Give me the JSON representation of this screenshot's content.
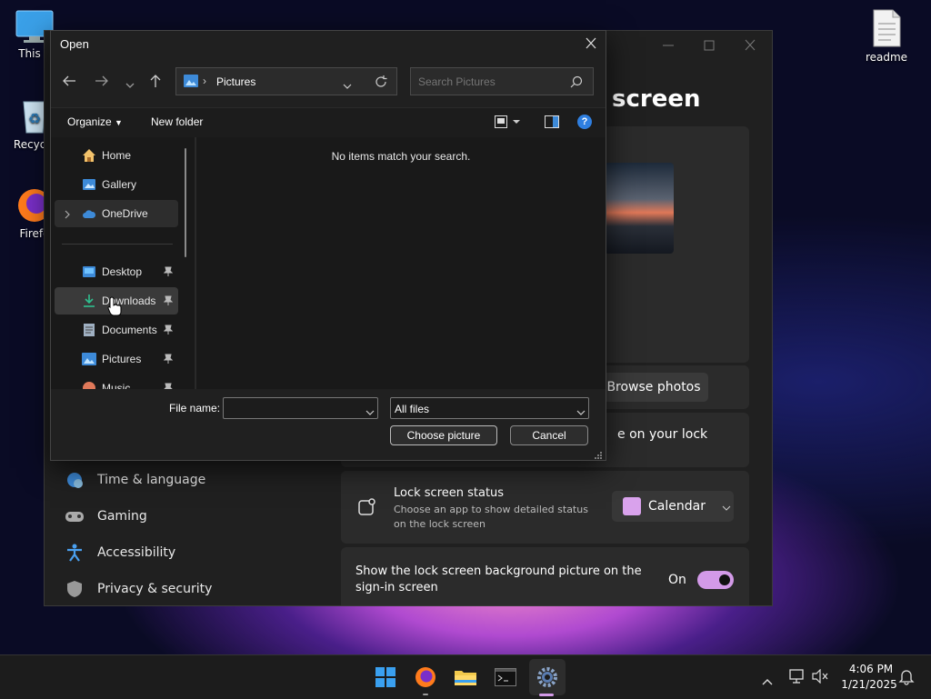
{
  "desktop": {
    "this_pc_label": "This P",
    "recycle_label": "Recycle",
    "firefox_label": "Firefo",
    "readme_label": "readme"
  },
  "settings": {
    "heading": "screen",
    "browse_photos": "Browse photos",
    "partial_text": "e on your lock",
    "nav": [
      {
        "label": "Time & language"
      },
      {
        "label": "Gaming"
      },
      {
        "label": "Accessibility"
      },
      {
        "label": "Privacy & security"
      }
    ],
    "lock_status_title": "Lock screen status",
    "lock_status_desc": "Choose an app to show detailed status on the lock screen",
    "lock_status_value": "Calendar",
    "signin_text": "Show the lock screen background picture on the sign-in screen",
    "signin_state": "On"
  },
  "dialog": {
    "title": "Open",
    "path": "Pictures",
    "search_placeholder": "Search Pictures",
    "organize": "Organize",
    "new_folder": "New folder",
    "empty_message": "No items match your search.",
    "tree": [
      {
        "label": "Home"
      },
      {
        "label": "Gallery"
      },
      {
        "label": "OneDrive"
      },
      {
        "label": "Desktop"
      },
      {
        "label": "Downloads"
      },
      {
        "label": "Documents"
      },
      {
        "label": "Pictures"
      },
      {
        "label": "Music"
      }
    ],
    "file_name_label": "File name:",
    "file_name_value": "",
    "file_type": "All files",
    "choose_button": "Choose picture",
    "cancel_button": "Cancel"
  },
  "taskbar": {
    "time": "4:06 PM",
    "date": "1/21/2025"
  },
  "colors": {
    "accent": "#d39ae8",
    "help_blue": "#2f7fe0",
    "dialog_bg": "#202020",
    "settings_bg": "#202020"
  }
}
